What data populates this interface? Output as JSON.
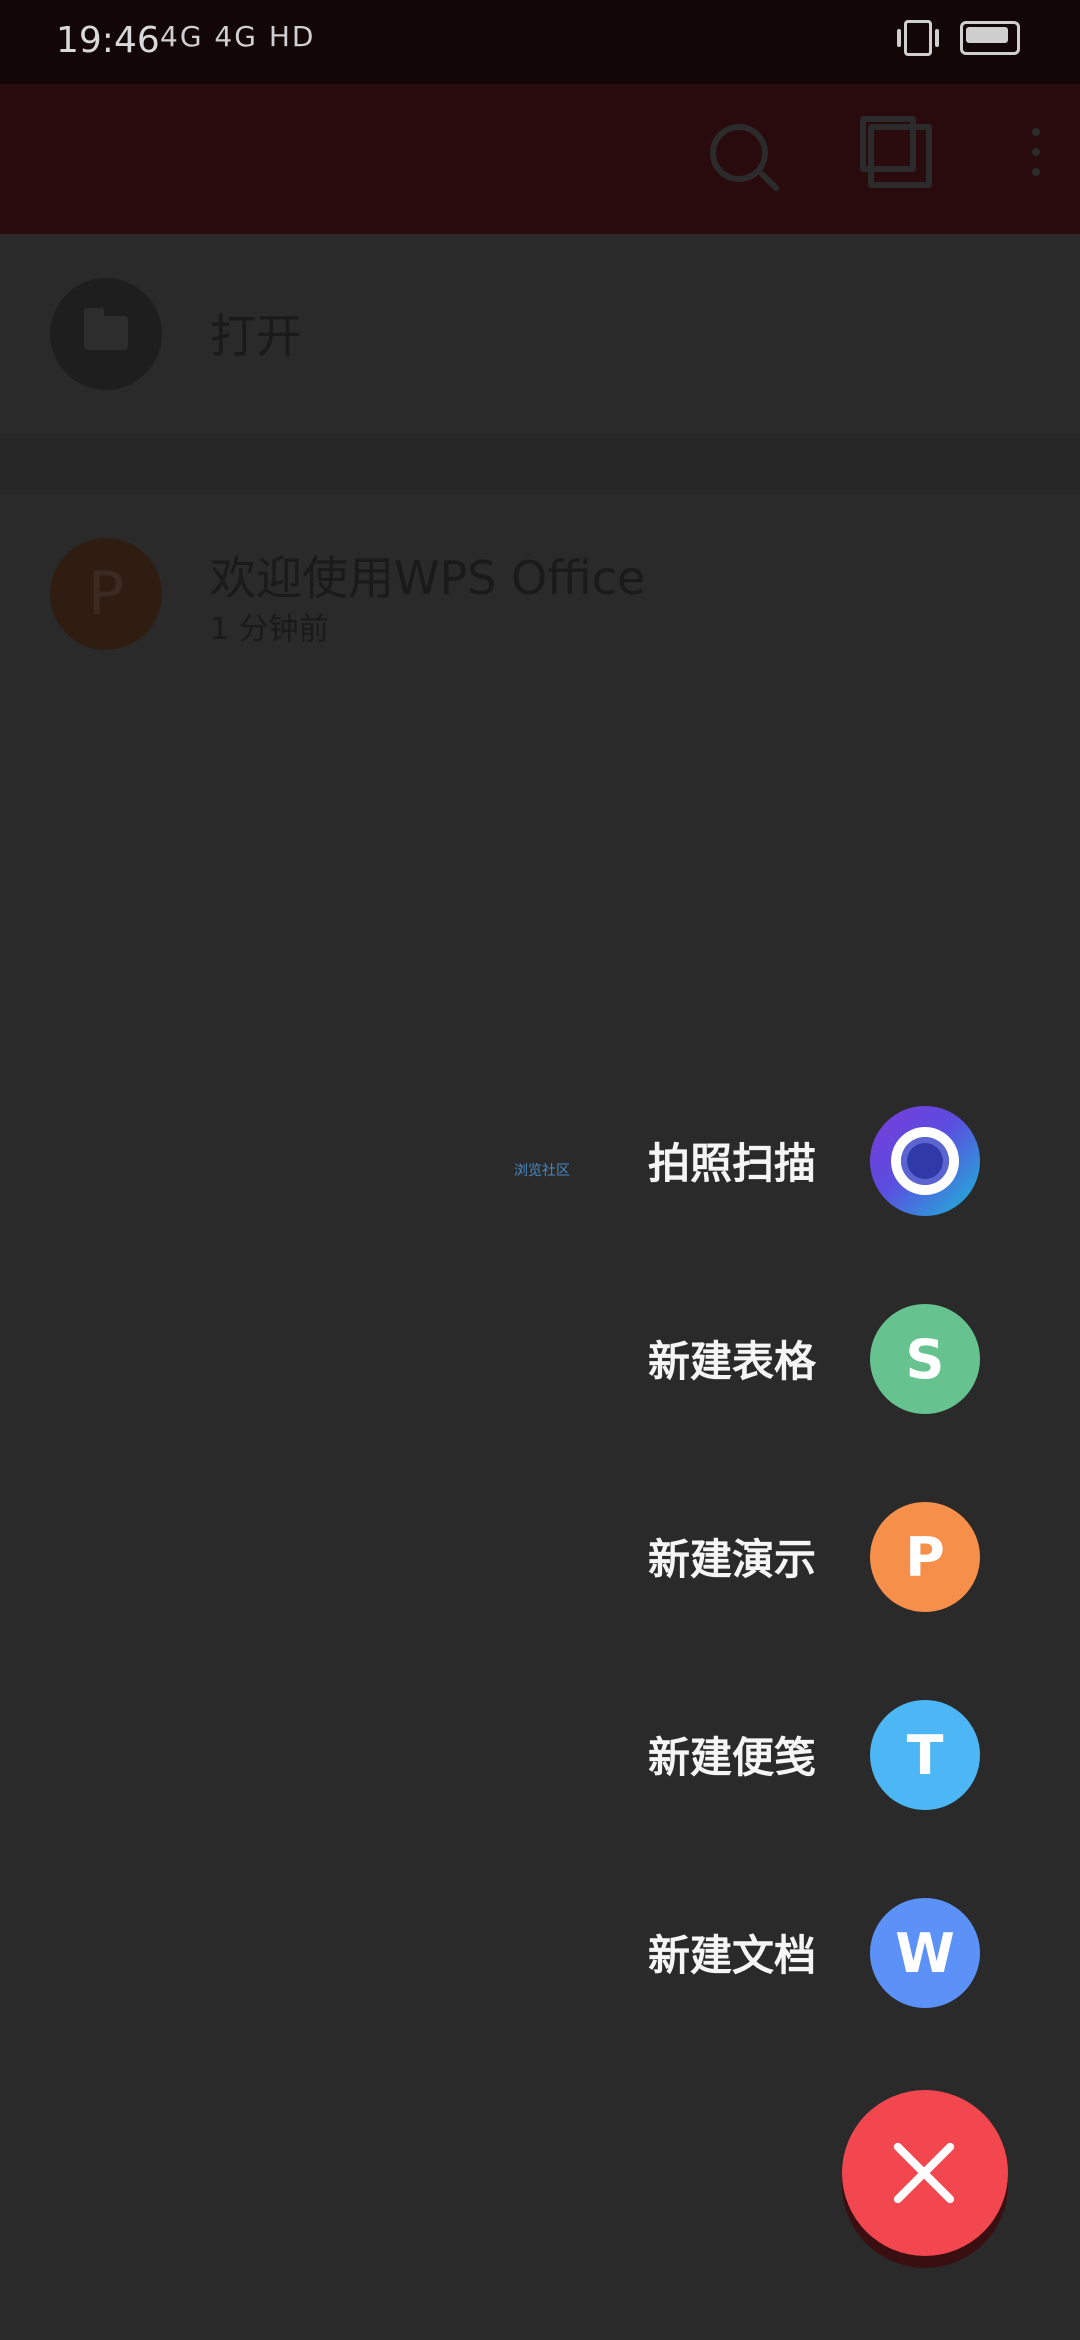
{
  "status_bar": {
    "time": "19:46",
    "signal_text": "4G 4G HD"
  },
  "open_row": {
    "label": "打开"
  },
  "recent": {
    "title": "欢迎使用WPS Office",
    "subtitle": "1 分钟前",
    "avatar_letter": "P"
  },
  "watermark": "浏览社区",
  "menu": [
    {
      "label": "拍照扫描",
      "color": "#6a46dd",
      "icon": "camera-icon"
    },
    {
      "label": "新建表格",
      "color": "#66c38f",
      "letter": "S",
      "icon": "spreadsheet-icon"
    },
    {
      "label": "新建演示",
      "color": "#f58f4a",
      "letter": "P",
      "icon": "presentation-icon"
    },
    {
      "label": "新建便笺",
      "color": "#4db6f4",
      "letter": "T",
      "icon": "note-icon"
    },
    {
      "label": "新建文档",
      "color": "#5c92f7",
      "letter": "W",
      "icon": "document-icon"
    }
  ],
  "fab": {
    "color": "#f3474f",
    "icon": "close-icon"
  }
}
